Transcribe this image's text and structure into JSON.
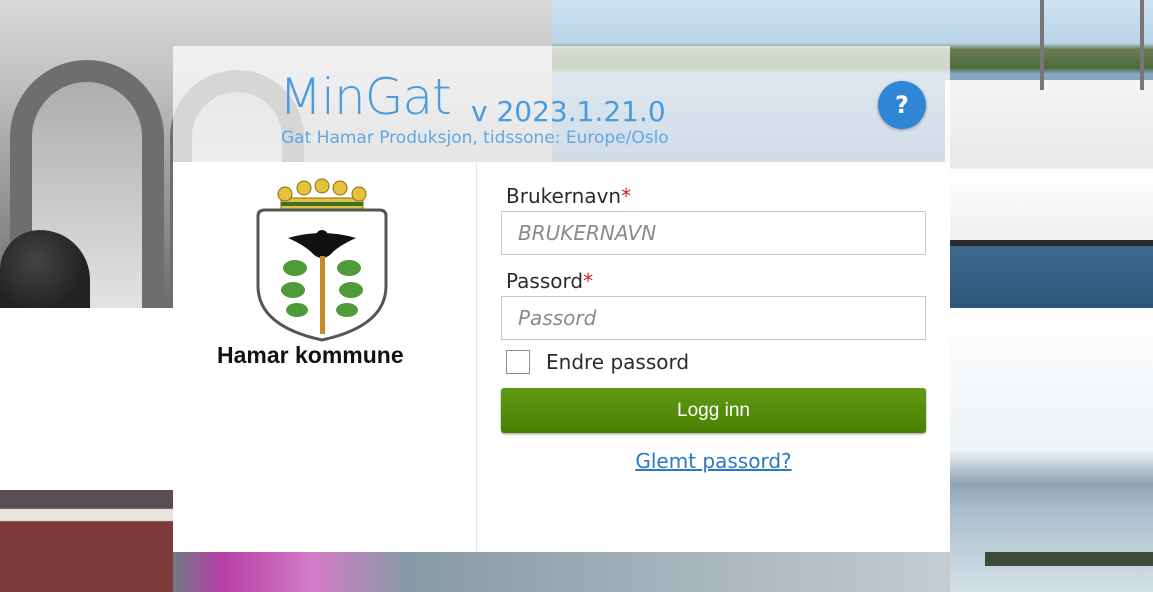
{
  "header": {
    "app_name": "MinGat",
    "version": "v 2023.1.21.0",
    "subtitle": "Gat Hamar Produksjon, tidssone: Europe/Oslo",
    "help_label": "?"
  },
  "logo": {
    "org_name": "Hamar kommune"
  },
  "form": {
    "username_label": "Brukernavn",
    "username_placeholder": "BRUKERNAVN",
    "username_value": "",
    "password_label": "Passord",
    "password_placeholder": "Passord",
    "password_value": "",
    "required_mark": "*",
    "change_password_label": "Endre passord",
    "change_password_checked": false,
    "login_button": "Logg inn",
    "forgot_password_link": "Glemt passord?"
  },
  "colors": {
    "accent": "#4a9be0",
    "help_button": "#2f86d6",
    "login_button": "#4e8508",
    "link": "#2d78c4",
    "required": "#d1222a"
  },
  "icons": {
    "help": "question-mark-icon",
    "logo": "coat-of-arms-icon"
  }
}
